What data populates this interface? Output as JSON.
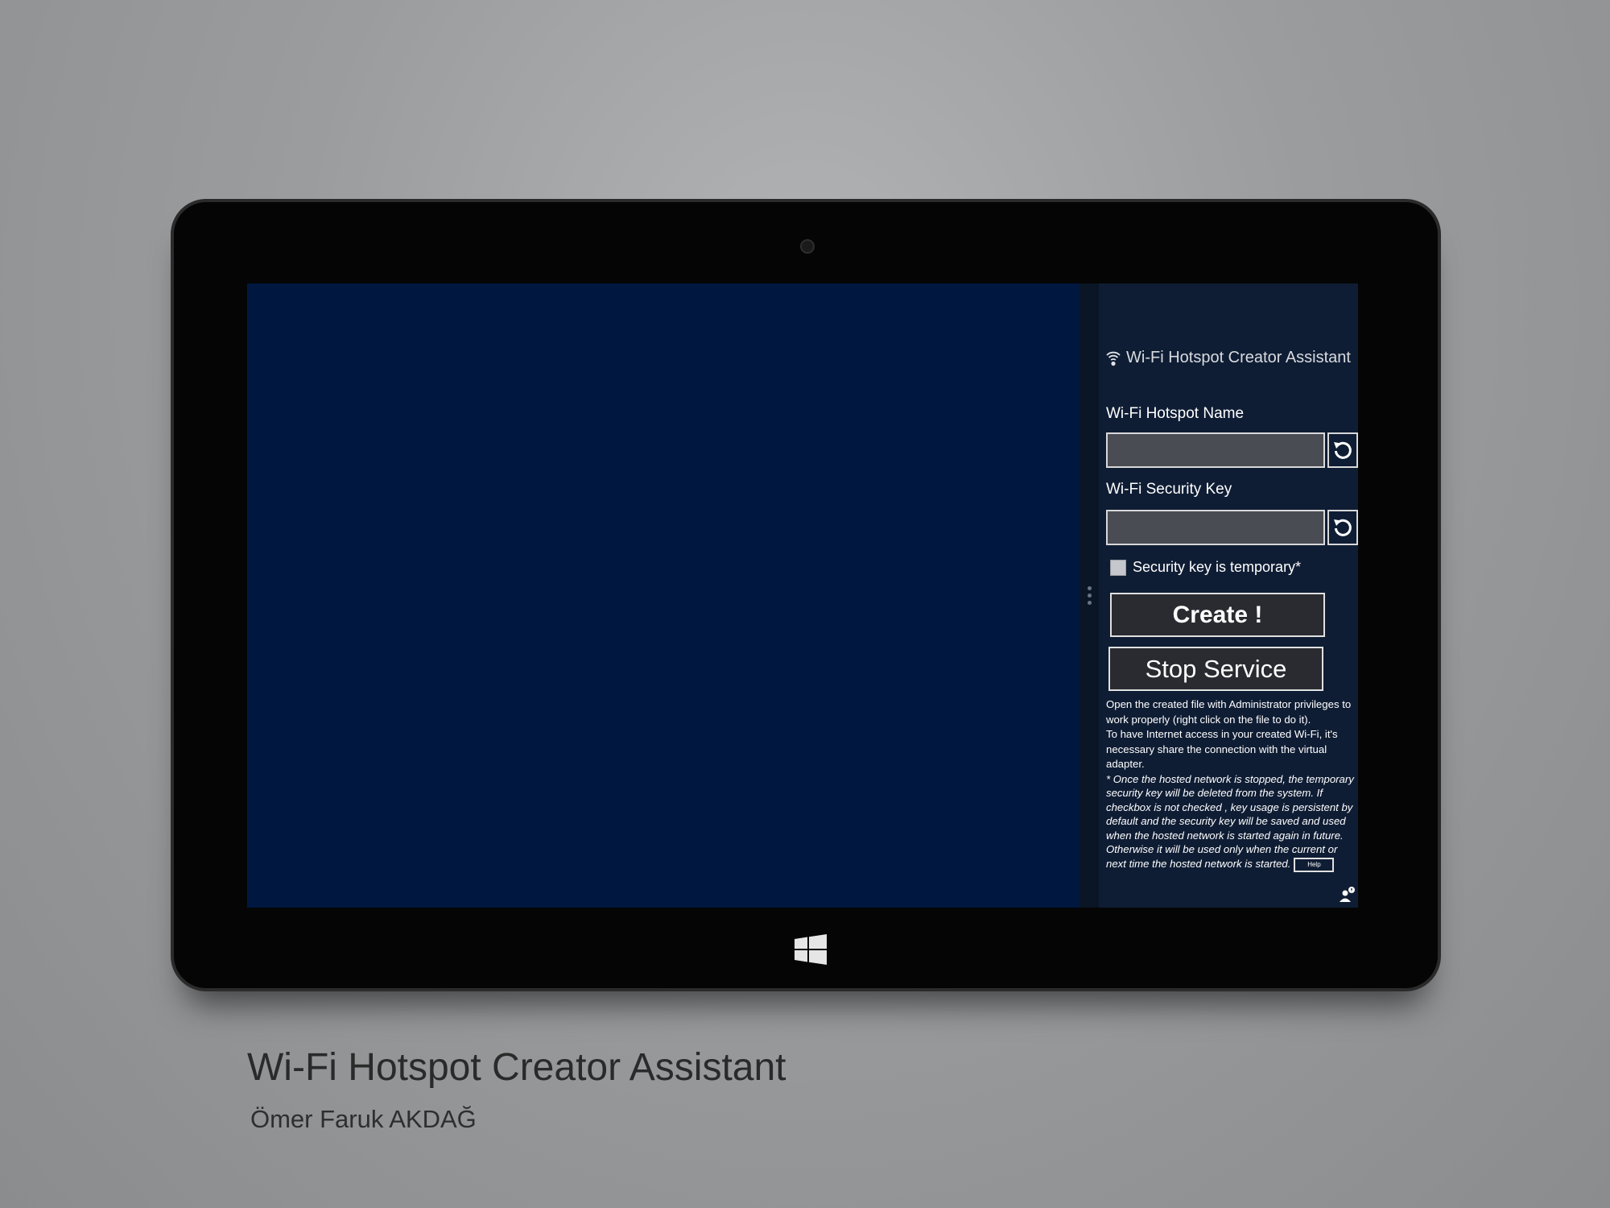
{
  "app": {
    "title": "Wi-Fi Hotspot Creator Assistant",
    "title_icon": "wifi-icon"
  },
  "form": {
    "hotspot_name_label": "Wi-Fi Hotspot Name",
    "hotspot_name_value": "",
    "security_key_label": "Wi-Fi  Security Key",
    "security_key_value": "",
    "reset_icon": "refresh-icon",
    "temporary_checkbox_label": "Security key is temporary*",
    "temporary_checkbox_checked": false
  },
  "buttons": {
    "create": "Create !",
    "stop": "Stop Service",
    "help": "Help"
  },
  "info": {
    "line1": "Open the created file with Administrator privileges to work properly (right click on the file to do it).",
    "line2": "To have Internet access in your created Wi-Fi, it's necessary share the connection with the virtual adapter.",
    "note": "*  Once the hosted network is stopped, the temporary security key will   be deleted  from the system. If checkbox is not checked , key usage  is persistent by default   and the security key will be saved and used when the hosted network is started again  in future.   Otherwise it will be used only when the current or next time the hosted network is started."
  },
  "caption": {
    "title": "Wi-Fi Hotspot Creator Assistant",
    "author": "Ömer Faruk AKDAĞ"
  },
  "colors": {
    "main_area": "#001840",
    "panel": "#0f1d34",
    "button_fill": "#2a2b31"
  }
}
